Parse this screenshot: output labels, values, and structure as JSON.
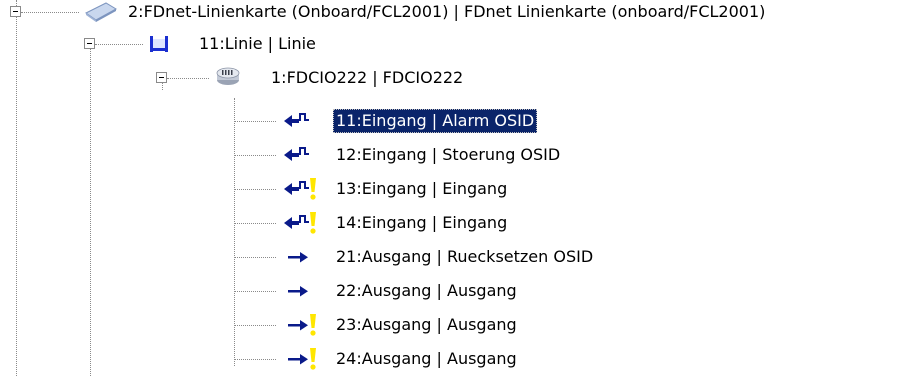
{
  "tree": {
    "nodes": [
      {
        "id": "n0",
        "level": 0,
        "label": "2:FDnet-Linienkarte (Onboard/FCL2001) | FDnet Linienkarte (onboard/FCL2001)",
        "icon": "network-card-icon",
        "expanded": true,
        "selected": false
      },
      {
        "id": "n1",
        "level": 1,
        "label": "11:Linie | Linie",
        "icon": "line-bracket-icon",
        "expanded": true,
        "selected": false
      },
      {
        "id": "n2",
        "level": 2,
        "label": "1:FDCIO222 | FDCIO222",
        "icon": "io-module-icon",
        "expanded": true,
        "selected": false
      },
      {
        "id": "n3",
        "level": 3,
        "label": "11:Eingang | Alarm OSID",
        "icon": "input-signal-icon",
        "warning": false,
        "selected": true
      },
      {
        "id": "n4",
        "level": 3,
        "label": "12:Eingang | Stoerung OSID",
        "icon": "input-signal-icon",
        "warning": false,
        "selected": false
      },
      {
        "id": "n5",
        "level": 3,
        "label": "13:Eingang | Eingang",
        "icon": "input-signal-icon",
        "warning": true,
        "selected": false
      },
      {
        "id": "n6",
        "level": 3,
        "label": "14:Eingang | Eingang",
        "icon": "input-signal-icon",
        "warning": true,
        "selected": false
      },
      {
        "id": "n7",
        "level": 3,
        "label": "21:Ausgang | Ruecksetzen OSID",
        "icon": "output-arrow-icon",
        "warning": false,
        "selected": false
      },
      {
        "id": "n8",
        "level": 3,
        "label": "22:Ausgang | Ausgang",
        "icon": "output-arrow-icon",
        "warning": false,
        "selected": false
      },
      {
        "id": "n9",
        "level": 3,
        "label": "23:Ausgang | Ausgang",
        "icon": "output-arrow-icon",
        "warning": true,
        "selected": false
      },
      {
        "id": "n10",
        "level": 3,
        "label": "24:Ausgang | Ausgang",
        "icon": "output-arrow-icon",
        "warning": true,
        "selected": false
      }
    ]
  },
  "colors": {
    "selection_background": "#0a246a",
    "selection_text": "#ffffff",
    "arrow_blue": "#0a1a8a",
    "warning_yellow": "#ffe600",
    "tree_line": "#8a8a8a"
  }
}
